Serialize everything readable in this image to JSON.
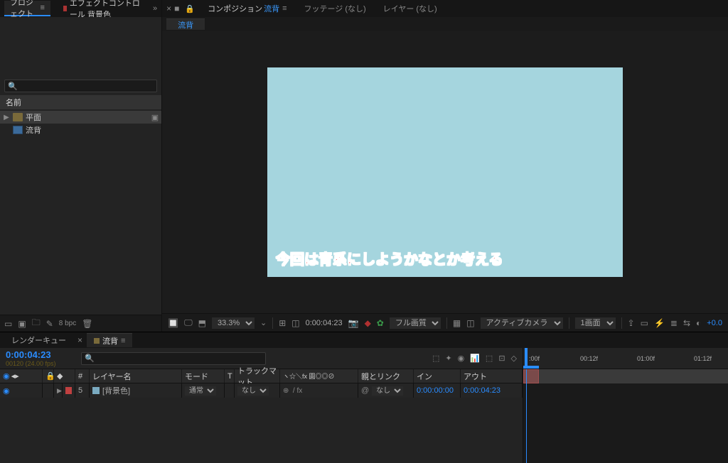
{
  "project_panel": {
    "tab_project": "プロジェクト",
    "tab_effects": "エフェクトコントロール 背景色",
    "search_placeholder": "",
    "col_name": "名前",
    "items": [
      {
        "label": "平面"
      },
      {
        "label": "流背"
      }
    ],
    "footer": {
      "bpc": "8 bpc"
    }
  },
  "viewer": {
    "tabs": {
      "composition_prefix": "コンポジション",
      "composition_name": "流背",
      "footage": "フッテージ (なし)",
      "layer": "レイヤー (なし)"
    },
    "chip": "流背",
    "caption": "今回は青系にしようかなとか考える",
    "canvas_color": "#a5d5de",
    "footer": {
      "zoom": "33.3%",
      "time": "0:00:04:23",
      "quality": "フル画質",
      "camera": "アクティブカメラ",
      "views": "1画面",
      "exposure": "+0.0"
    }
  },
  "timeline": {
    "tab_render": "レンダーキュー",
    "tab_comp": "流背",
    "timecode": "0:00:04:23",
    "timecode_sub": "00120 (24.00 fps)",
    "search_placeholder": "",
    "headers": {
      "num": "#",
      "layer_name": "レイヤー名",
      "mode": "モード",
      "track_matte": "トラックマット",
      "switches": "ヽ☆＼fx 圓◎◎⊘",
      "parent": "親とリンク",
      "in": "イン",
      "out": "アウト",
      "t": "T"
    },
    "layer": {
      "num": "5",
      "name": "[背景色]",
      "mode": "通常",
      "matte": "なし",
      "parent": "なし",
      "in": "0:00:00:00",
      "out": "0:00:04:23"
    },
    "ruler": {
      "t0": ":00f",
      "t1": "00:12f",
      "t2": "01:00f",
      "t3": "01:12f"
    }
  }
}
